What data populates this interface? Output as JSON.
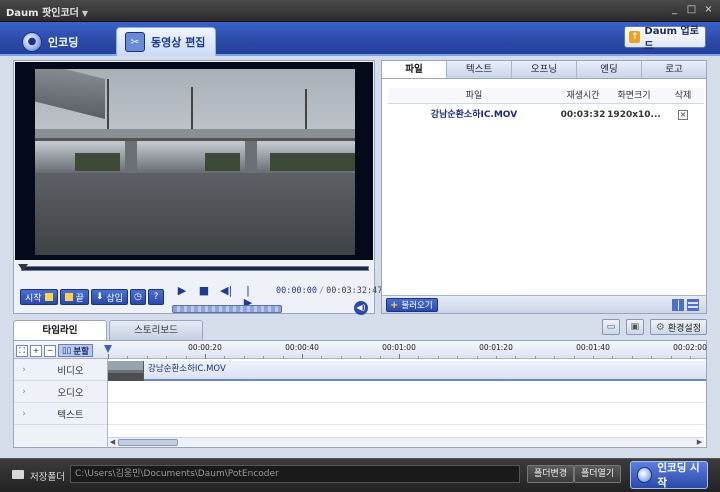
{
  "window": {
    "title": "Daum 팟인코더",
    "minimize": "_",
    "maximize": "□",
    "close": "×"
  },
  "top_tabs": [
    {
      "label": "인코딩",
      "active": false
    },
    {
      "label": "동영상 편집",
      "active": true
    }
  ],
  "upload_button": "Daum 업로드",
  "player": {
    "controls": {
      "start": "시작",
      "end": "끝",
      "insert": "삽입",
      "help": "?"
    },
    "current_time": "00:00:00",
    "separator": "/",
    "total_time": "00:03:32:47",
    "seek_position": 0
  },
  "file_panel": {
    "tabs": [
      "파일",
      "텍스트",
      "오프닝",
      "엔딩",
      "로고"
    ],
    "active_tab": "파일",
    "columns": [
      "파일",
      "재생시간",
      "화면크기",
      "삭제"
    ],
    "rows": [
      {
        "name": "강남순환소하IC.MOV",
        "duration": "00:03:32",
        "size": "1920x10...",
        "delete": "×"
      }
    ],
    "load_button": "불러오기"
  },
  "timeline_tabs": [
    {
      "label": "타임라인",
      "active": true
    },
    {
      "label": "스토리보드",
      "active": false
    }
  ],
  "settings_button": "환경설정",
  "timeline": {
    "split_label": "분할",
    "ticks": [
      "00:00:20",
      "00:00:40",
      "00:01:00",
      "00:01:20",
      "00:01:40",
      "00:02:00"
    ],
    "tracks": [
      "비디오",
      "오디오",
      "텍스트"
    ],
    "clip_name": "강남순환소하IC.MOV"
  },
  "bottom": {
    "folder_label": "저장폴더",
    "path": "C:\\Users\\김웅민\\Documents\\Daum\\PotEncoder",
    "change_folder": "폴더변경",
    "open_folder": "폴더열기",
    "start_button": "인코딩 시작"
  },
  "colors": {
    "accent": "#2a4aa8",
    "header_bg": "#3a62c8",
    "panel_bg": "#d5dcea"
  }
}
